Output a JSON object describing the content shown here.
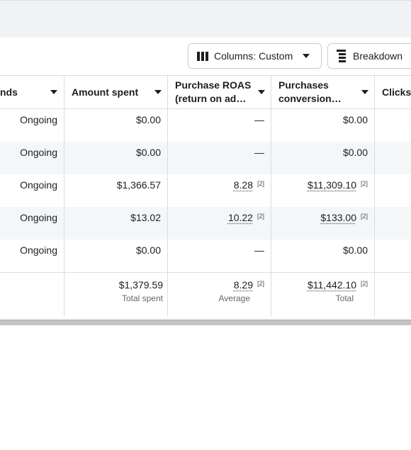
{
  "toolbar": {
    "columns_label": "Columns: Custom",
    "breakdown_label": "Breakdown"
  },
  "table": {
    "headers": {
      "ends": "nds",
      "amount_spent": "Amount spent",
      "roas_line1": "Purchase ROAS",
      "roas_line2": "(return on ad…",
      "purchases_line1": "Purchases",
      "purchases_line2": "conversion…",
      "clicks": "Clicks"
    },
    "rows": [
      {
        "ends": "Ongoing",
        "amount": "$0.00",
        "roas": "—",
        "purchases": "$0.00"
      },
      {
        "ends": "Ongoing",
        "amount": "$0.00",
        "roas": "—",
        "purchases": "$0.00"
      },
      {
        "ends": "Ongoing",
        "amount": "$1,366.57",
        "roas": "8.28",
        "roas_note": "[2]",
        "purchases": "$11,309.10",
        "purchases_note": "[2]"
      },
      {
        "ends": "Ongoing",
        "amount": "$13.02",
        "roas": "10.22",
        "roas_note": "[2]",
        "purchases": "$133.00",
        "purchases_note": "[2]"
      },
      {
        "ends": "Ongoing",
        "amount": "$0.00",
        "roas": "—",
        "purchases": "$0.00"
      }
    ],
    "totals": {
      "amount": "$1,379.59",
      "amount_label": "Total spent",
      "roas": "8.29",
      "roas_note": "[2]",
      "roas_label": "Average",
      "purchases": "$11,442.10",
      "purchases_note": "[2]",
      "purchases_label": "Total"
    }
  }
}
